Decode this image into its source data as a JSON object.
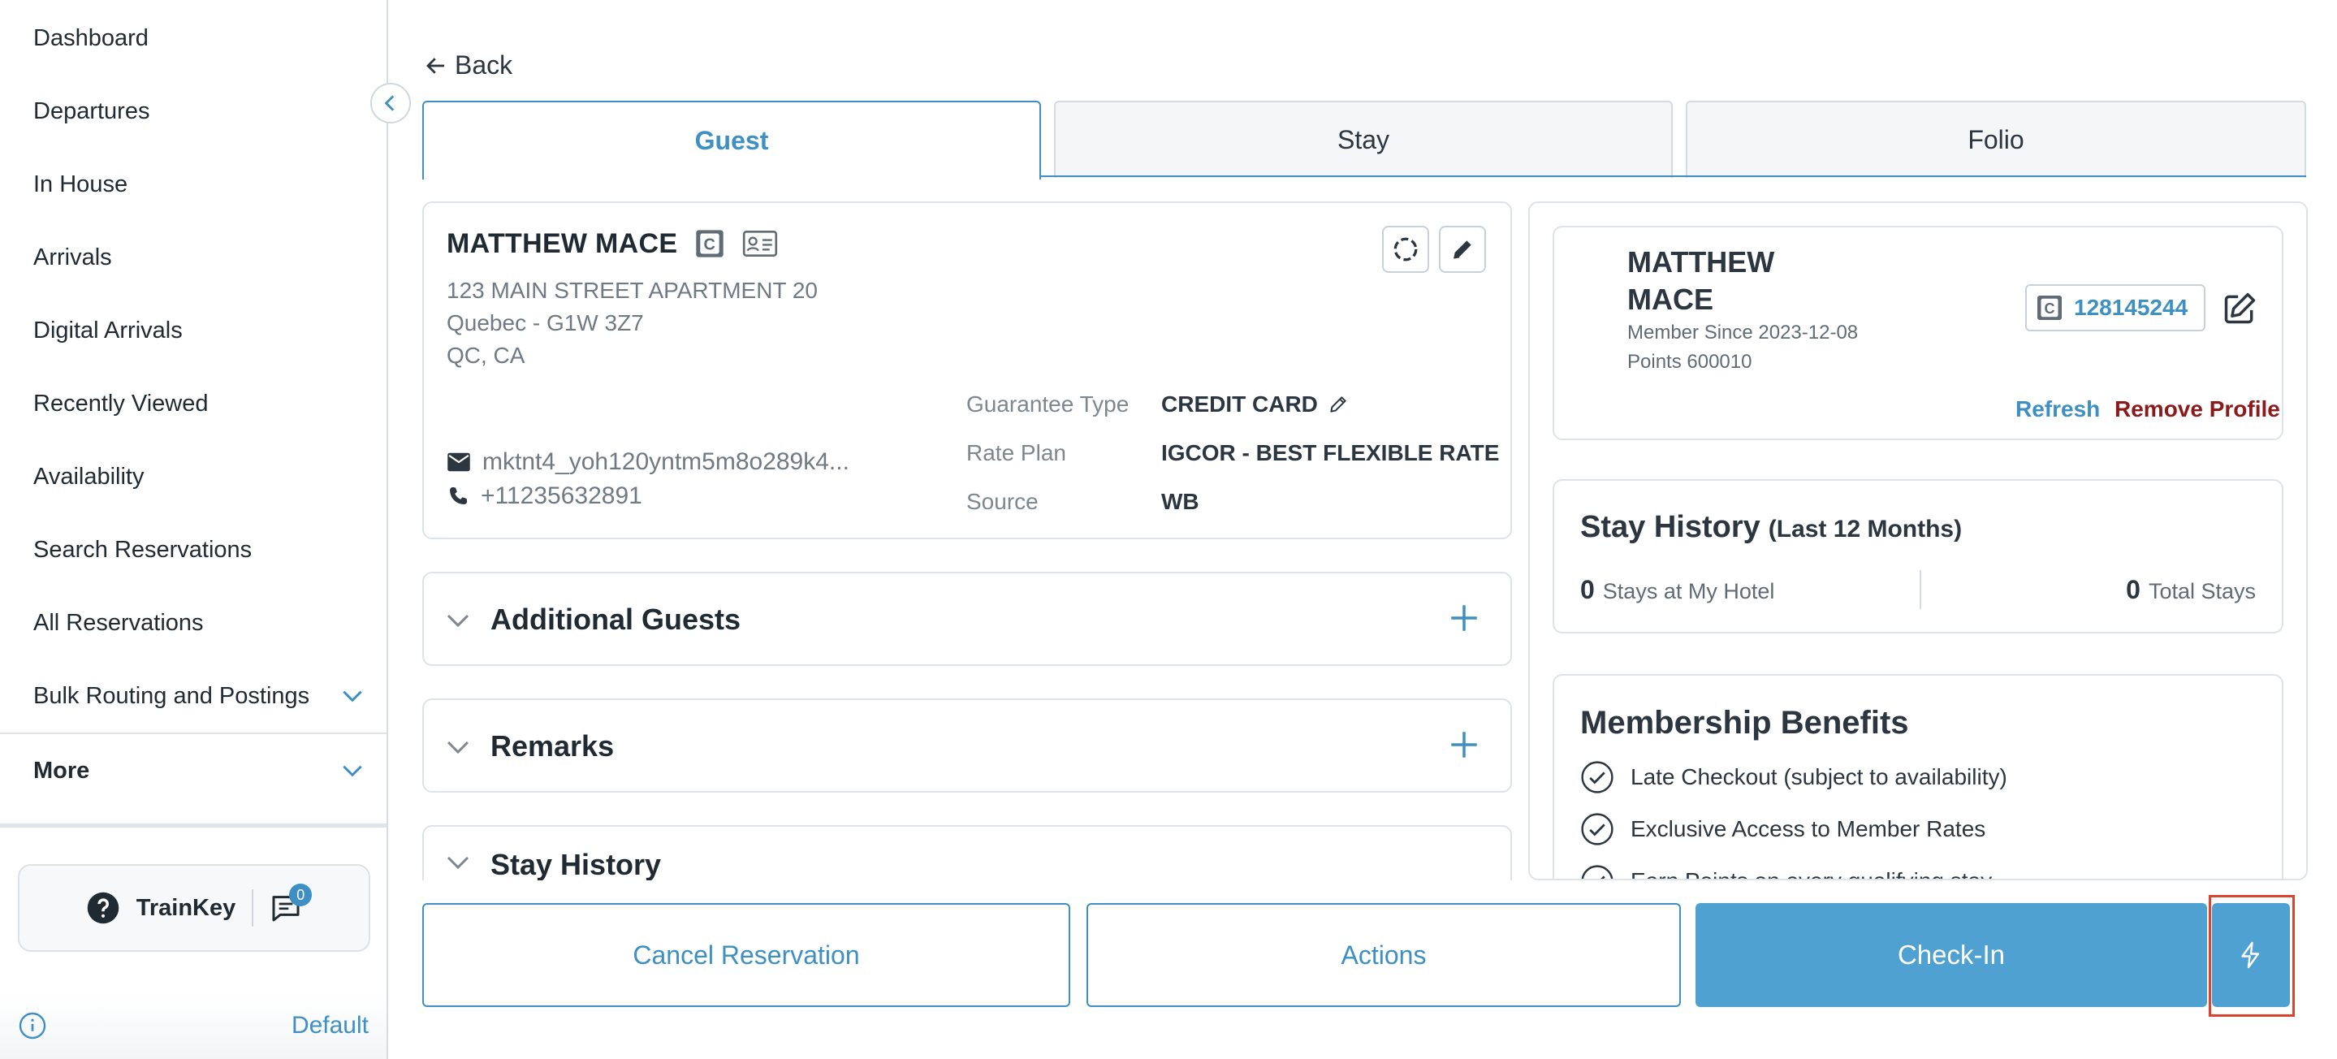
{
  "sidebar": {
    "items": [
      {
        "label": "Dashboard"
      },
      {
        "label": "Departures"
      },
      {
        "label": "In House"
      },
      {
        "label": "Arrivals"
      },
      {
        "label": "Digital Arrivals"
      },
      {
        "label": "Recently Viewed"
      },
      {
        "label": "Availability"
      },
      {
        "label": "Search Reservations"
      },
      {
        "label": "All Reservations"
      },
      {
        "label": "Bulk Routing and Postings"
      },
      {
        "label": "More"
      }
    ],
    "trainkey_label": "TrainKey",
    "messages_count": "0",
    "profile_label": "Default"
  },
  "back_label": "Back",
  "tabs": [
    {
      "label": "Guest"
    },
    {
      "label": "Stay"
    },
    {
      "label": "Folio"
    }
  ],
  "guest": {
    "name": "MATTHEW MACE",
    "address_line1": "123 MAIN STREET APARTMENT 20",
    "address_line2": "Quebec  - G1W 3Z7",
    "address_line3": "QC, CA",
    "email": "mktnt4_yoh120yntm5m8o289k4...",
    "phone": "+11235632891",
    "guarantee_type_label": "Guarantee Type",
    "guarantee_type_value": "CREDIT CARD",
    "rate_plan_label": "Rate Plan",
    "rate_plan_value": "IGCOR - BEST FLEXIBLE RATE",
    "source_label": "Source",
    "source_value": "WB"
  },
  "accordions": [
    {
      "title": "Additional Guests"
    },
    {
      "title": "Remarks"
    },
    {
      "title": "Stay History"
    }
  ],
  "member": {
    "first_name": "MATTHEW",
    "last_name": "MACE",
    "member_since": "Member Since 2023-12-08",
    "points": "Points 600010",
    "number": "128145244",
    "refresh_label": "Refresh",
    "remove_label": "Remove Profile"
  },
  "stay_history": {
    "title": "Stay History",
    "subtitle": "(Last 12 Months)",
    "stays_hotel_count": "0",
    "stays_hotel_label": "Stays at My Hotel",
    "total_stays_count": "0",
    "total_stays_label": "Total Stays"
  },
  "benefits": {
    "title": "Membership Benefits",
    "items": [
      "Late Checkout (subject to availability)",
      "Exclusive Access to Member Rates",
      "Earn Points on every qualifying stay"
    ]
  },
  "footer": {
    "cancel_label": "Cancel Reservation",
    "actions_label": "Actions",
    "checkin_label": "Check-In"
  },
  "colors": {
    "accent": "#3e8fc4",
    "primary_button": "#4fa1d2",
    "remove_link": "#8b1a1a",
    "highlight_box": "#d9432f"
  }
}
